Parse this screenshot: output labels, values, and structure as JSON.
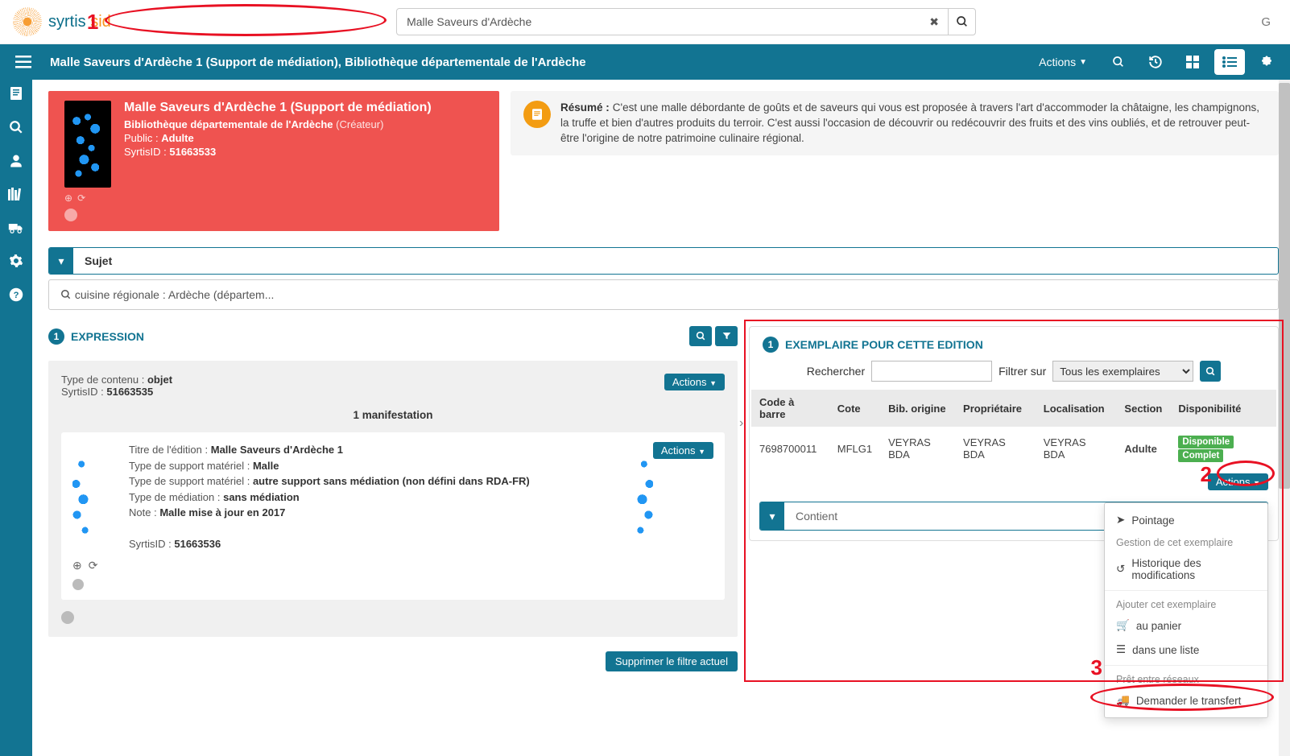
{
  "search": {
    "value": "Malle Saveurs d'Ardèche"
  },
  "top_g": "G",
  "pageTitle": "Malle Saveurs d'Ardèche 1 (Support de médiation), Bibliothèque départementale de l'Ardèche",
  "actions": "Actions",
  "record": {
    "title": "Malle Saveurs d'Ardèche 1  (Support de médiation)",
    "creator_line": "Bibliothèque départementale de l'Ardèche",
    "creator_suffix": "(Créateur)",
    "public_label": "Public :",
    "public_value": "Adulte",
    "syrtisid_label": "SyrtisID :",
    "syrtisid_value": "51663533"
  },
  "resume": {
    "label": "Résumé :",
    "text": "C'est une malle débordante de goûts et de saveurs qui vous est proposée à travers l'art d'accommoder la châtaigne, les champignons, la truffe et bien d'autres produits du terroir. C'est aussi l'occasion de découvrir ou redécouvrir des fruits et des vins oubliés, et de retrouver peut-être l'origine de notre patrimoine culinaire régional."
  },
  "subject": {
    "label": "Sujet",
    "search_text": "cuisine régionale : Ardèche (départem..."
  },
  "expression": {
    "count": "1",
    "label": "EXPRESSION",
    "content_label": "Type de contenu :",
    "content_value": "objet",
    "id_label": "SyrtisID :",
    "id_value": "51663535",
    "actions": "Actions",
    "manif_count": "1 manifestation",
    "manif": {
      "title_label": "Titre de l'édition :",
      "title_value": "Malle Saveurs d'Ardèche 1",
      "sup_label": "Type de support matériel :",
      "sup_value1": "Malle",
      "sup_value2": "autre support sans médiation (non défini dans RDA-FR)",
      "med_label": "Type de médiation :",
      "med_value": "sans médiation",
      "note_label": "Note :",
      "note_value": "Malle mise à jour en 2017",
      "id_label": "SyrtisID :",
      "id_value": "51663536",
      "actions": "Actions"
    }
  },
  "removeFilter": "Supprimer le filtre actuel",
  "exemplaire": {
    "count": "1",
    "title": "EXEMPLAIRE POUR CETTE EDITION",
    "search_label": "Rechercher",
    "filter_label": "Filtrer sur",
    "filter_value": "Tous les exemplaires",
    "cols": {
      "barcode": "Code à barre",
      "cote": "Cote",
      "origin": "Bib. origine",
      "owner": "Propriétaire",
      "loc": "Localisation",
      "section": "Section",
      "avail": "Disponibilité"
    },
    "row": {
      "barcode": "7698700011",
      "cote": "MFLG1",
      "origin": "VEYRAS BDA",
      "owner": "VEYRAS BDA",
      "loc": "VEYRAS BDA",
      "section": "Adulte",
      "avail1": "Disponible",
      "avail2": "Complet"
    },
    "row_actions": "Actions",
    "contient": "Contient"
  },
  "dropdown": {
    "pointage": "Pointage",
    "h1": "Gestion de cet exemplaire",
    "hist": "Historique des modifications",
    "h2": "Ajouter cet exemplaire",
    "panier": "au panier",
    "liste": "dans une liste",
    "h3": "Prêt entre réseaux",
    "transfert": "Demander le transfert"
  },
  "annot": {
    "n1": "1",
    "n2": "2",
    "n3": "3"
  }
}
